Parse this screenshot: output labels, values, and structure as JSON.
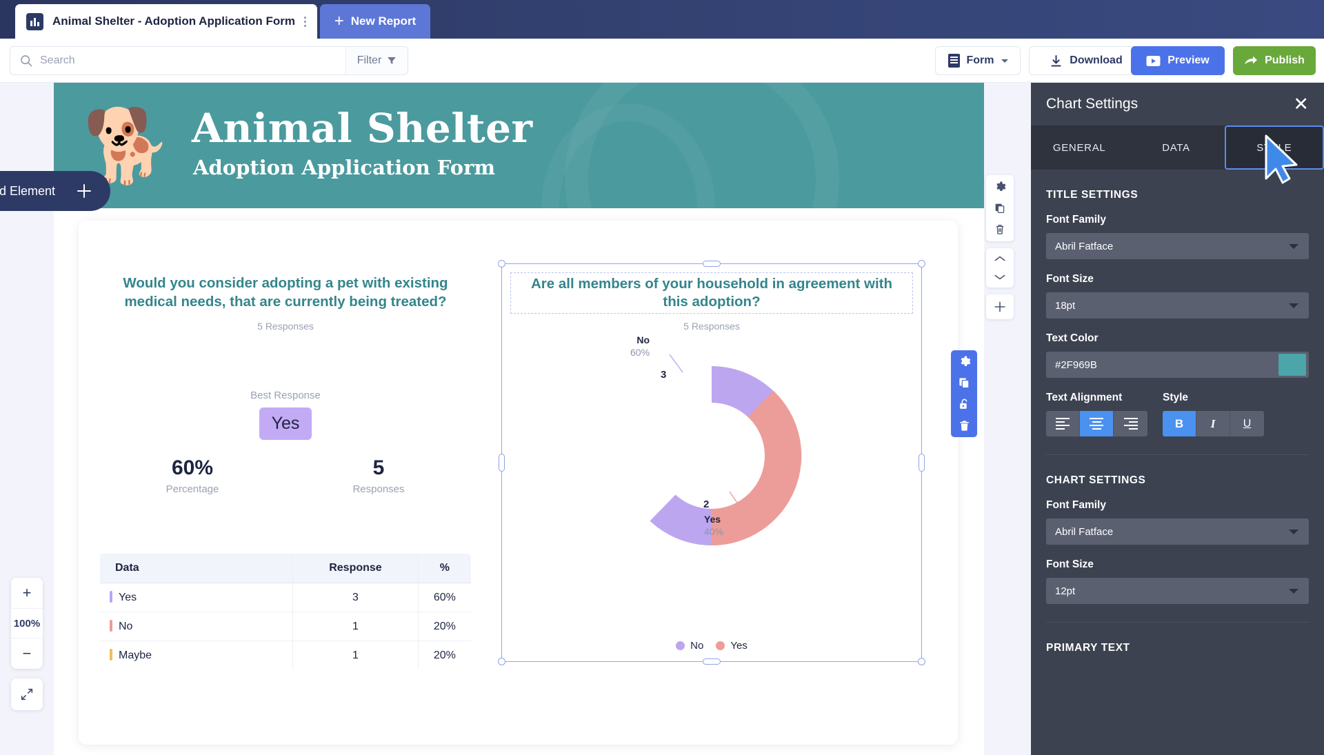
{
  "tabbar": {
    "document_tab_title": "Animal Shelter - Adoption Application Form",
    "new_report_label": "New Report",
    "plus": "+"
  },
  "toolbar": {
    "search_placeholder": "Search",
    "filter_label": "Filter",
    "form_label": "Form",
    "download_label": "Download",
    "preview_label": "Preview",
    "publish_label": "Publish"
  },
  "canvas": {
    "add_element_label": "Add Element",
    "add_element_plus": "+",
    "zoom_in": "+",
    "zoom_level": "100%",
    "zoom_out": "−",
    "banner": {
      "title": "Animal Shelter",
      "subtitle": "Adoption Application Form",
      "dog_emoji": "🐕",
      "bg_color": "#4B9A9E"
    }
  },
  "left_widget": {
    "question": "Would you consider adopting a pet with existing medical needs, that are currently being treated?",
    "responses_label": "5 Responses",
    "best_response_label": "Best Response",
    "best_response_value": "Yes",
    "stats": [
      {
        "value": "60%",
        "label": "Percentage"
      },
      {
        "value": "5",
        "label": "Responses"
      }
    ],
    "table": {
      "columns": [
        "Data",
        "Response",
        "%"
      ],
      "rows": [
        {
          "data": "Yes",
          "response": "3",
          "percent": "60%",
          "color": "#B9A4F2"
        },
        {
          "data": "No",
          "response": "1",
          "percent": "20%",
          "color": "#EE9A96"
        },
        {
          "data": "Maybe",
          "response": "1",
          "percent": "20%",
          "color": "#EFBE5C"
        }
      ]
    }
  },
  "chart_data": {
    "type": "pie",
    "title": "Are all members of your household in agreement with this adoption?",
    "subtitle": "5 Responses",
    "categories": [
      "No",
      "Yes"
    ],
    "values": [
      3,
      2
    ],
    "percent_labels": [
      "60%",
      "40%"
    ],
    "colors": [
      "#BCA6F0",
      "#EC9D99"
    ],
    "legend": [
      "No",
      "Yes"
    ],
    "legend_position": "bottom",
    "donut": true,
    "label_no_name": "No",
    "label_no_pct": "60%",
    "label_yes_name": "Yes",
    "label_yes_pct": "40%",
    "value_no": "3",
    "value_yes": "2"
  },
  "panel": {
    "heading": "Chart Settings",
    "close": "✕",
    "tabs": [
      {
        "label": "GENERAL",
        "selected": false
      },
      {
        "label": "DATA",
        "selected": false
      },
      {
        "label": "STYLE",
        "selected": true
      }
    ],
    "title_settings": {
      "section": "TITLE SETTINGS",
      "font_family_label": "Font Family",
      "font_family_value": "Abril Fatface",
      "font_size_label": "Font Size",
      "font_size_value": "18pt",
      "text_color_label": "Text Color",
      "text_color_value": "#2F969B",
      "text_color_swatch": "#4BA5A9",
      "text_alignment_label": "Text Alignment",
      "style_label": "Style",
      "bold": "B",
      "italic": "I",
      "underline": "U"
    },
    "chart_settings": {
      "section": "CHART SETTINGS",
      "font_family_label": "Font Family",
      "font_family_value": "Abril Fatface",
      "font_size_label": "Font Size",
      "font_size_value": "12pt"
    },
    "primary_text_section": "PRIMARY TEXT"
  }
}
